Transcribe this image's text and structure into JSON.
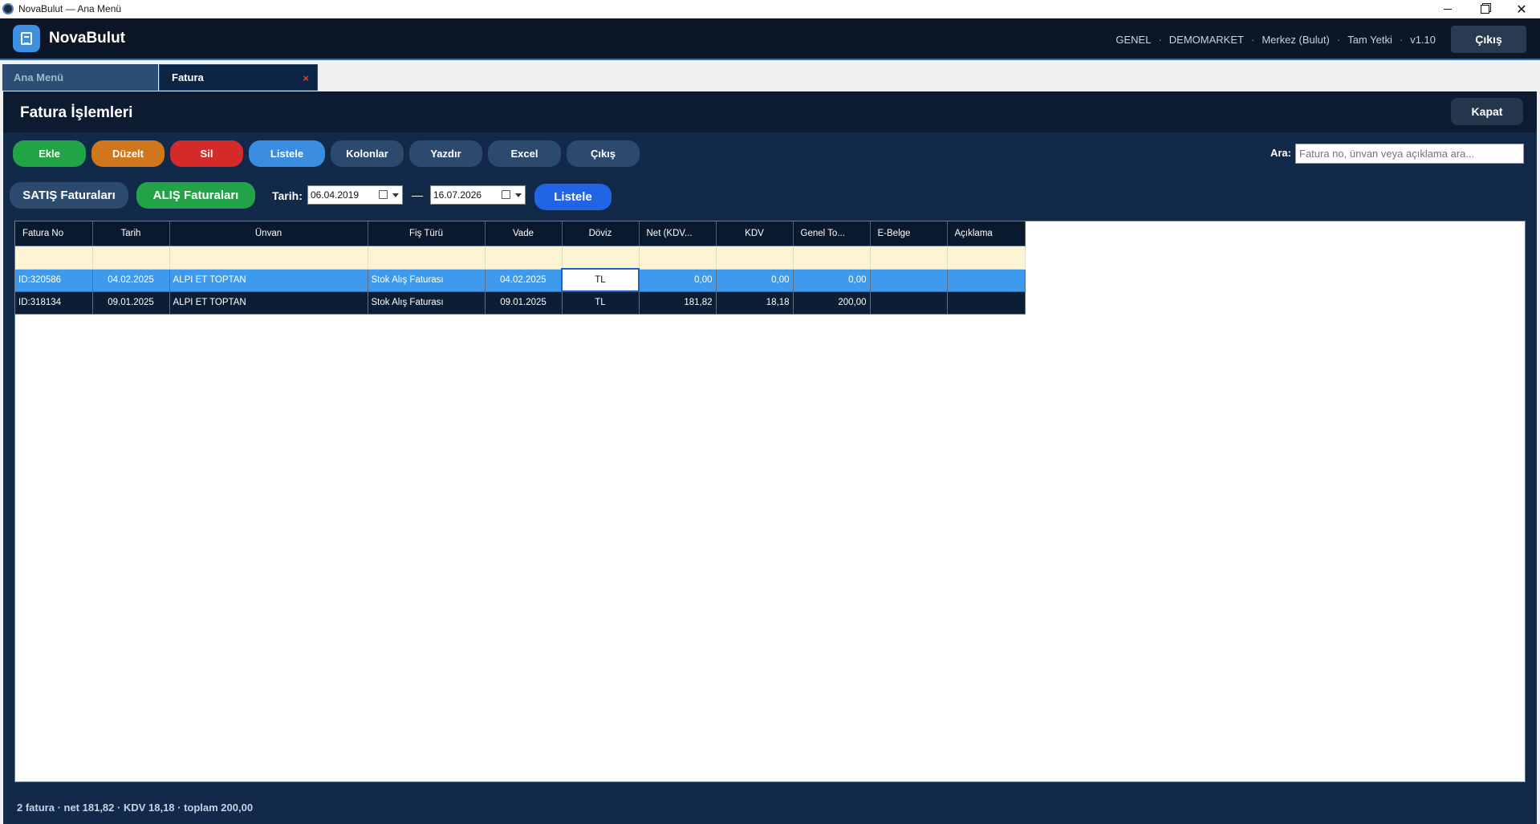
{
  "os": {
    "title": "NovaBulut — Ana Menü"
  },
  "header": {
    "brand": "NovaBulut",
    "info": [
      "GENEL",
      "DEMOMARKET",
      "Merkez (Bulut)",
      "Tam Yetki",
      "v1.10"
    ],
    "separator": "·",
    "exit_label": "Çıkış"
  },
  "tabs": [
    {
      "label": "Ana Menü",
      "active": false
    },
    {
      "label": "Fatura",
      "active": true,
      "close": "×"
    }
  ],
  "panel": {
    "title": "Fatura İşlemleri",
    "close_label": "Kapat"
  },
  "toolbar": {
    "ekle": "Ekle",
    "duzelt": "Düzelt",
    "sil": "Sil",
    "listele": "Listele",
    "kolonlar": "Kolonlar",
    "yazdir": "Yazdır",
    "excel": "Excel",
    "cikis": "Çıkış"
  },
  "search": {
    "label": "Ara:",
    "placeholder": "Fatura no, ünvan veya açıklama ara..."
  },
  "filters": {
    "satis": "SATIŞ Faturaları",
    "alis": "ALIŞ Faturaları",
    "tarih_label": "Tarih:",
    "date_from": "06.04.2019",
    "dash": "—",
    "date_to": "16.07.2026",
    "listele": "Listele"
  },
  "table": {
    "columns": [
      "Fatura No",
      "Tarih",
      "Ünvan",
      "Fiş Türü",
      "Vade",
      "Döviz",
      "Net (KDV...",
      "KDV",
      "Genel To...",
      "E-Belge",
      "Açıklama"
    ],
    "rows": [
      {
        "fatura_no": "ID:320586",
        "tarih": "04.02.2025",
        "unvan": "ALPI ET TOPTAN",
        "fis_turu": "Stok Alış Faturası",
        "vade": "04.02.2025",
        "doviz": "TL",
        "net": "0,00",
        "kdv": "0,00",
        "genel_toplam": "0,00",
        "ebelge": "",
        "aciklama": ""
      },
      {
        "fatura_no": "ID:318134",
        "tarih": "09.01.2025",
        "unvan": "ALPI ET TOPTAN",
        "fis_turu": "Stok Alış Faturası",
        "vade": "09.01.2025",
        "doviz": "TL",
        "net": "181,82",
        "kdv": "18,18",
        "genel_toplam": "200,00",
        "ebelge": "",
        "aciklama": ""
      }
    ]
  },
  "status": {
    "summary": "2 fatura · net 181,82 · KDV 18,18 · toplam 200,00"
  },
  "colors": {
    "header_bg": "#0b1626",
    "panel_bg": "#12294a",
    "green": "#23a348",
    "orange": "#d0761d",
    "red": "#d42a2a",
    "blue": "#3a8de0",
    "selected_row": "#3e9aec",
    "filter_row": "#fdf4d4"
  }
}
